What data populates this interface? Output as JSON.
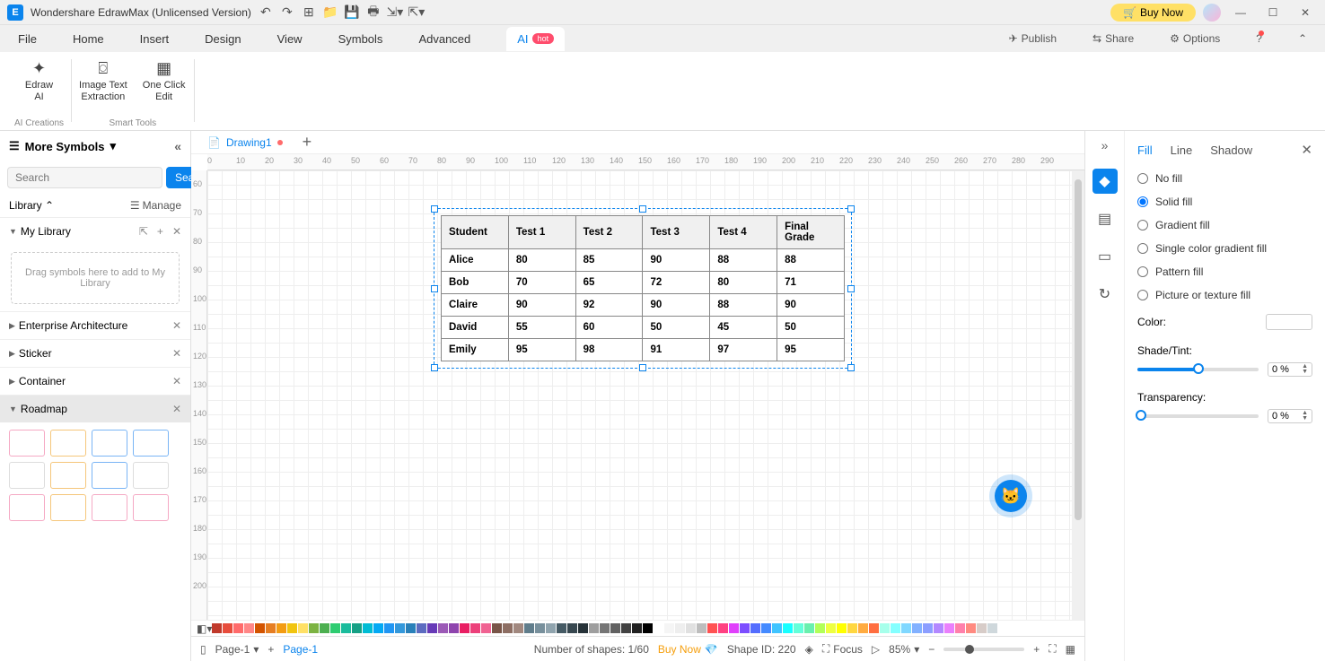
{
  "titlebar": {
    "title": "Wondershare EdrawMax (Unlicensed Version)",
    "buy_now": "Buy Now"
  },
  "menubar": {
    "items": [
      "File",
      "Home",
      "Insert",
      "Design",
      "View",
      "Symbols",
      "Advanced"
    ],
    "ai_tab": "AI",
    "hot": "hot",
    "publish": "Publish",
    "share": "Share",
    "options": "Options"
  },
  "ribbon": {
    "edraw_ai": "Edraw\nAI",
    "image_text": "Image Text\nExtraction",
    "one_click": "One Click\nEdit",
    "group1": "AI Creations",
    "group2": "Smart Tools"
  },
  "left_panel": {
    "header": "More Symbols",
    "search_placeholder": "Search",
    "search_btn": "Search",
    "library_label": "Library",
    "manage": "Manage",
    "my_library": "My Library",
    "drop_hint": "Drag symbols here to add to My Library",
    "sections": [
      "Enterprise Architecture",
      "Sticker",
      "Container",
      "Roadmap"
    ]
  },
  "doc_tabs": {
    "tab1": "Drawing1"
  },
  "ruler_h": [
    "0",
    "10",
    "20",
    "30",
    "40",
    "50",
    "60",
    "70",
    "80",
    "90",
    "100",
    "110",
    "120",
    "130",
    "140",
    "150",
    "160",
    "170",
    "180",
    "190",
    "200",
    "210",
    "220",
    "230",
    "240",
    "250",
    "260",
    "270",
    "280",
    "290"
  ],
  "ruler_v": [
    "60",
    "70",
    "80",
    "90",
    "100",
    "110",
    "120",
    "130",
    "140",
    "150",
    "160",
    "170",
    "180",
    "190",
    "200"
  ],
  "table": {
    "headers": [
      "Student",
      "Test 1",
      "Test 2",
      "Test 3",
      "Test 4",
      "Final Grade"
    ],
    "rows": [
      [
        "Alice",
        "80",
        "85",
        "90",
        "88",
        "88"
      ],
      [
        "Bob",
        "70",
        "65",
        "72",
        "80",
        "71"
      ],
      [
        "Claire",
        "90",
        "92",
        "90",
        "88",
        "90"
      ],
      [
        "David",
        "55",
        "60",
        "50",
        "45",
        "50"
      ],
      [
        "Emily",
        "95",
        "98",
        "91",
        "97",
        "95"
      ]
    ]
  },
  "right_panel": {
    "tabs": [
      "Fill",
      "Line",
      "Shadow"
    ],
    "fill_options": [
      "No fill",
      "Solid fill",
      "Gradient fill",
      "Single color gradient fill",
      "Pattern fill",
      "Picture or texture fill"
    ],
    "color_label": "Color:",
    "shade_label": "Shade/Tint:",
    "shade_value": "0 %",
    "transparency_label": "Transparency:",
    "transparency_value": "0 %"
  },
  "statusbar": {
    "page_select": "Page-1",
    "page_tab": "Page-1",
    "shapes": "Number of shapes: 1/60",
    "buy_now": "Buy Now",
    "shape_id": "Shape ID: 220",
    "focus": "Focus",
    "zoom": "85%"
  },
  "colors": [
    "#c0392b",
    "#e74c3c",
    "#ff6b6b",
    "#ff8787",
    "#d35400",
    "#e67e22",
    "#f39c12",
    "#f1c40f",
    "#ffe066",
    "#7cb342",
    "#4caf50",
    "#2ecc71",
    "#1abc9c",
    "#16a085",
    "#00bcd4",
    "#03a9f4",
    "#2196f3",
    "#3498db",
    "#2980b9",
    "#5c6bc0",
    "#673ab7",
    "#9b59b6",
    "#8e44ad",
    "#e91e63",
    "#ec407a",
    "#f06292",
    "#795548",
    "#8d6e63",
    "#a1887f",
    "#607d8b",
    "#78909c",
    "#90a4ae",
    "#455a64",
    "#37474f",
    "#263238",
    "#9e9e9e",
    "#757575",
    "#616161",
    "#424242",
    "#212121",
    "#000000",
    "#ffffff",
    "#f5f5f5",
    "#eeeeee",
    "#e0e0e0",
    "#bdbdbd",
    "#ff5252",
    "#ff4081",
    "#e040fb",
    "#7c4dff",
    "#536dfe",
    "#448aff",
    "#40c4ff",
    "#18ffff",
    "#64ffda",
    "#69f0ae",
    "#b2ff59",
    "#eeff41",
    "#ffff00",
    "#ffd740",
    "#ffab40",
    "#ff6e40",
    "#a7ffeb",
    "#84ffff",
    "#80d8ff",
    "#82b1ff",
    "#8c9eff",
    "#b388ff",
    "#ea80fc",
    "#ff80ab",
    "#ff8a80",
    "#d7ccc8",
    "#cfd8dc"
  ]
}
